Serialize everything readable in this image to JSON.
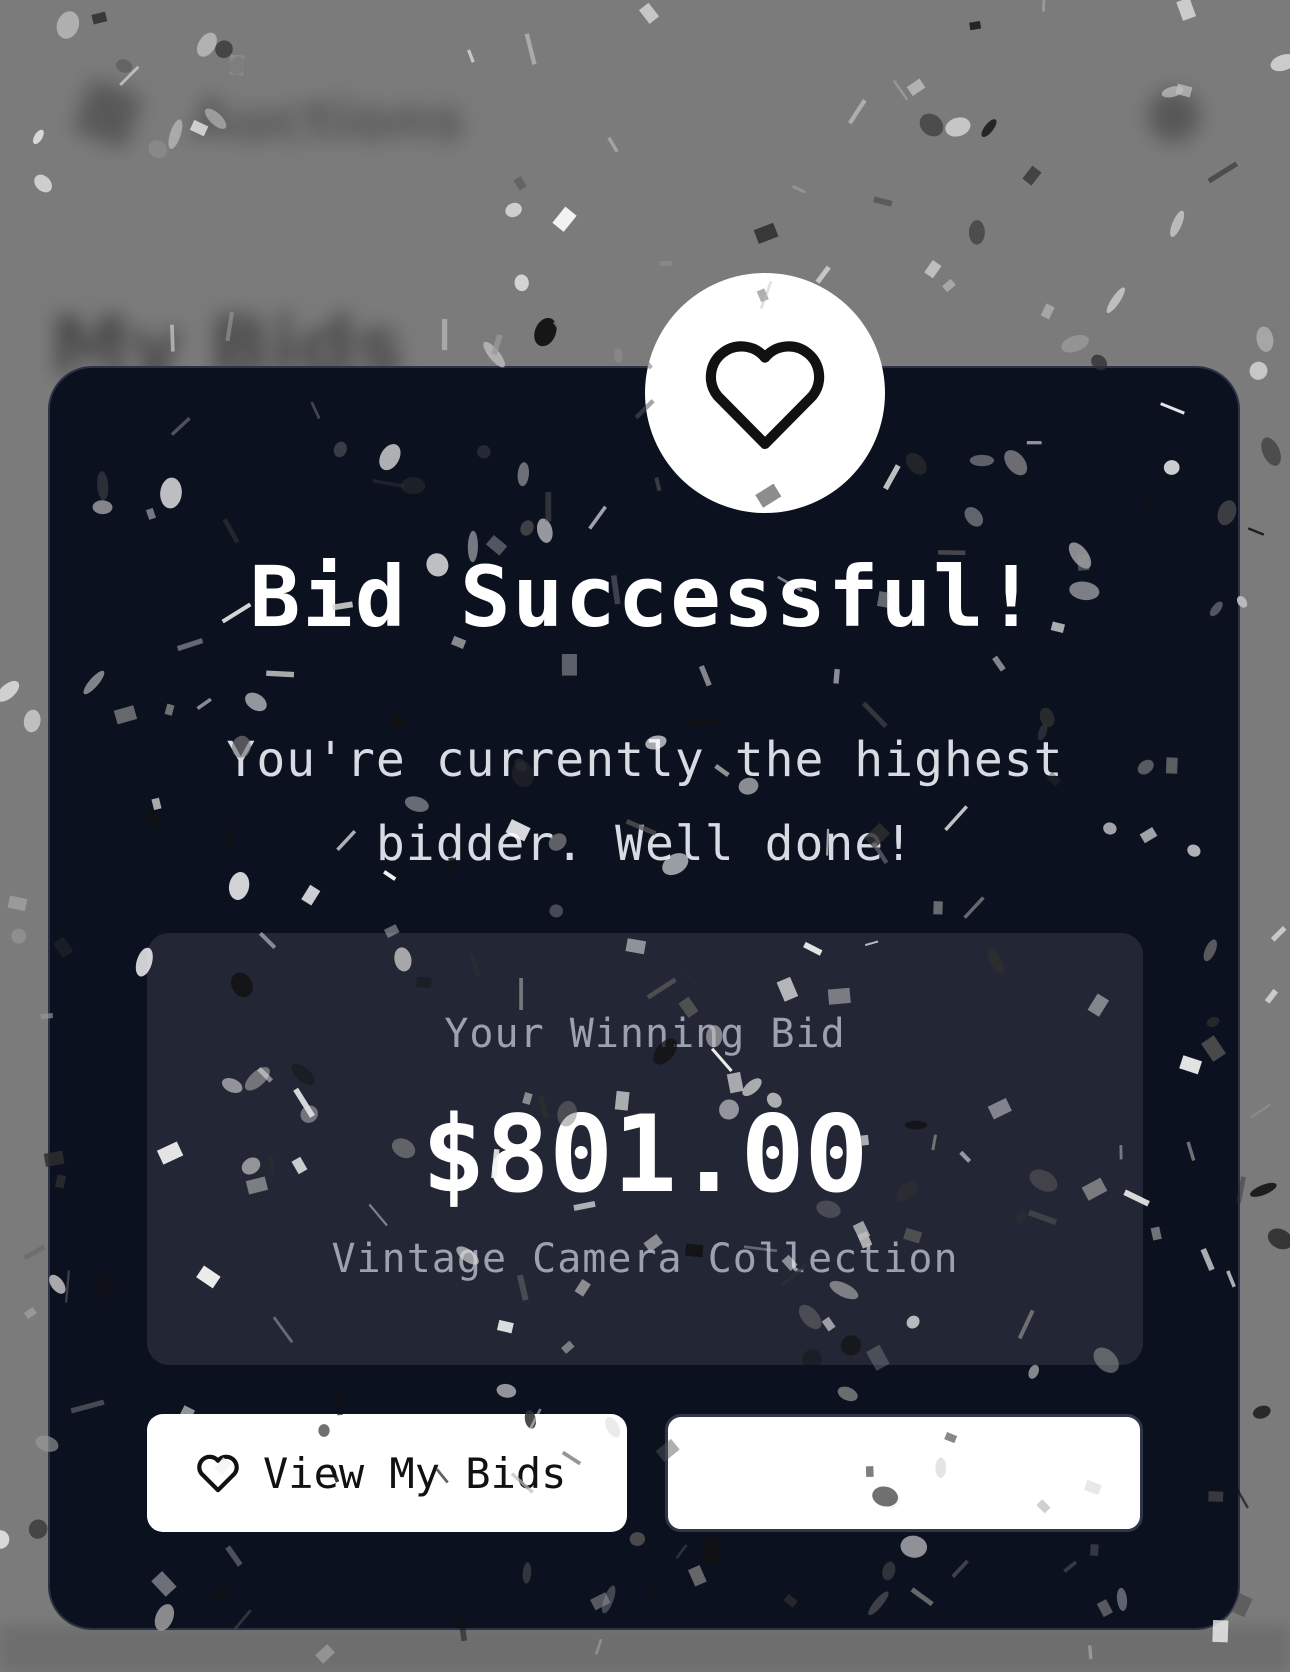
{
  "background": {
    "brand": "Auctions",
    "page_title": "My Bids"
  },
  "modal": {
    "icon": "heart-icon",
    "title": "Bid Successful!",
    "message": "You're currently the highest bidder. Well done!",
    "bid_label": "Your Winning Bid",
    "bid_amount": "$801.00",
    "item_name": "Vintage Camera Collection",
    "primary_button": {
      "icon": "heart-icon",
      "label": "View My Bids"
    },
    "secondary_button": {
      "label": ""
    }
  },
  "colors": {
    "modal_bg": "#0c1120",
    "panel_bg": "#232735",
    "backdrop": "#7b7b7b",
    "button_bg": "#ffffff"
  }
}
